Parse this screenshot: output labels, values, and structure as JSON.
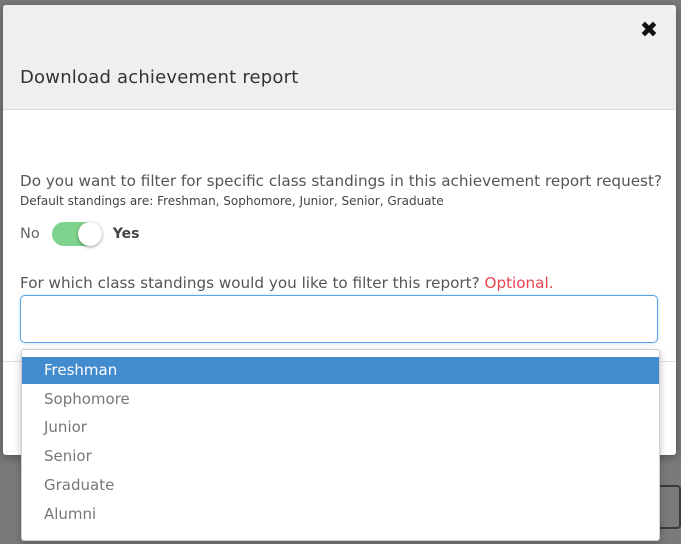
{
  "modal": {
    "title": "Download achievement report",
    "close_icon": "close-icon",
    "question": "Do you want to filter for specific class standings in this achievement report request?",
    "hint": "Default standings are: Freshman, Sophomore, Junior, Senior, Graduate",
    "toggle": {
      "off_label": "No",
      "on_label": "Yes",
      "state": "on",
      "color": "#7ed48c"
    },
    "filter_question": "For which class standings would you like to filter this report?",
    "optional_label": "Optional.",
    "select_input": {
      "value": "",
      "placeholder": ""
    }
  },
  "dropdown": {
    "options": [
      {
        "label": "Freshman",
        "highlighted": true
      },
      {
        "label": "Sophomore",
        "highlighted": false
      },
      {
        "label": "Junior",
        "highlighted": false
      },
      {
        "label": "Senior",
        "highlighted": false
      },
      {
        "label": "Graduate",
        "highlighted": false
      },
      {
        "label": "Alumni",
        "highlighted": false
      }
    ],
    "highlight_color": "#428bce"
  },
  "colors": {
    "accent": "#428bce",
    "optional_red": "#e8434f",
    "focus_border": "#5ba4e6"
  }
}
